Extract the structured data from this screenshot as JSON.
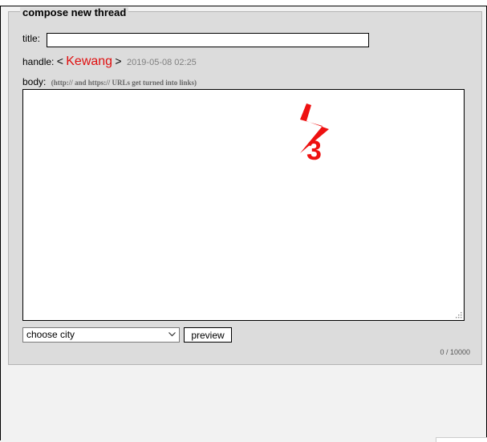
{
  "compose": {
    "legend": "compose new thread",
    "title_label": "title:",
    "title_value": "",
    "handle_label": "handle:",
    "handle_open": "<",
    "handle_name": "Kewang",
    "handle_close": ">",
    "handle_date": "2019-05-08 02:25",
    "body_label": "body:",
    "body_hint": "(http:// and https:// URLs get turned into links)",
    "body_value": "",
    "city_select": "choose city",
    "preview_label": "preview",
    "counter": "0 / 10000"
  },
  "colors": {
    "handle_name": "#e01010",
    "logo": "#ee1111",
    "panel_bg": "#dcdcdc"
  },
  "icons": {
    "logo": "lightning-3-logo",
    "select_arrow": "chevron-down-icon",
    "resize": "resize-grip-icon"
  }
}
